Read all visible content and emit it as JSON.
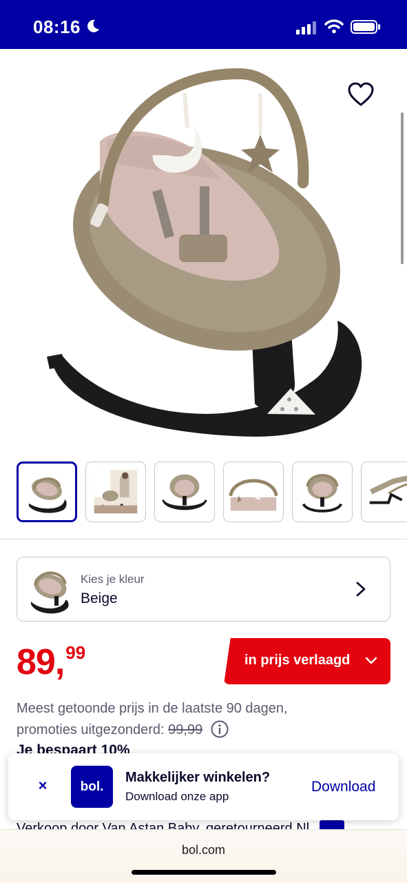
{
  "status_bar": {
    "time": "08:16",
    "icons": [
      "moon-icon",
      "signal-icon",
      "wifi-icon",
      "battery-icon"
    ]
  },
  "product": {
    "image_alt_name": "product-image",
    "favorite_icon": "heart-icon",
    "thumbnails_count": 6,
    "active_thumbnail": 1
  },
  "color_selector": {
    "label": "Kies je kleur",
    "value": "Beige"
  },
  "price": {
    "integer": "89",
    "comma": ",",
    "decimals": "99",
    "badge_label": "in prijs verlaagd",
    "note_line1": "Meest getoonde prijs in de laatste 90 dagen,",
    "note_line2_prefix": "promoties uitgezonderd:",
    "old_price": "99,99",
    "savings": "Je bespaart 10%"
  },
  "app_banner": {
    "close": "×",
    "logo": "bol.",
    "title": "Makkelijker winkelen?",
    "subtitle": "Download onze app",
    "action": "Download"
  },
  "peek": {
    "text": "Verkoop door Van Astan Baby, geretourneerd Nl"
  },
  "browser": {
    "address": "bol.com"
  },
  "colors": {
    "brand_blue": "#0000a4",
    "sale_red": "#e3040f"
  }
}
